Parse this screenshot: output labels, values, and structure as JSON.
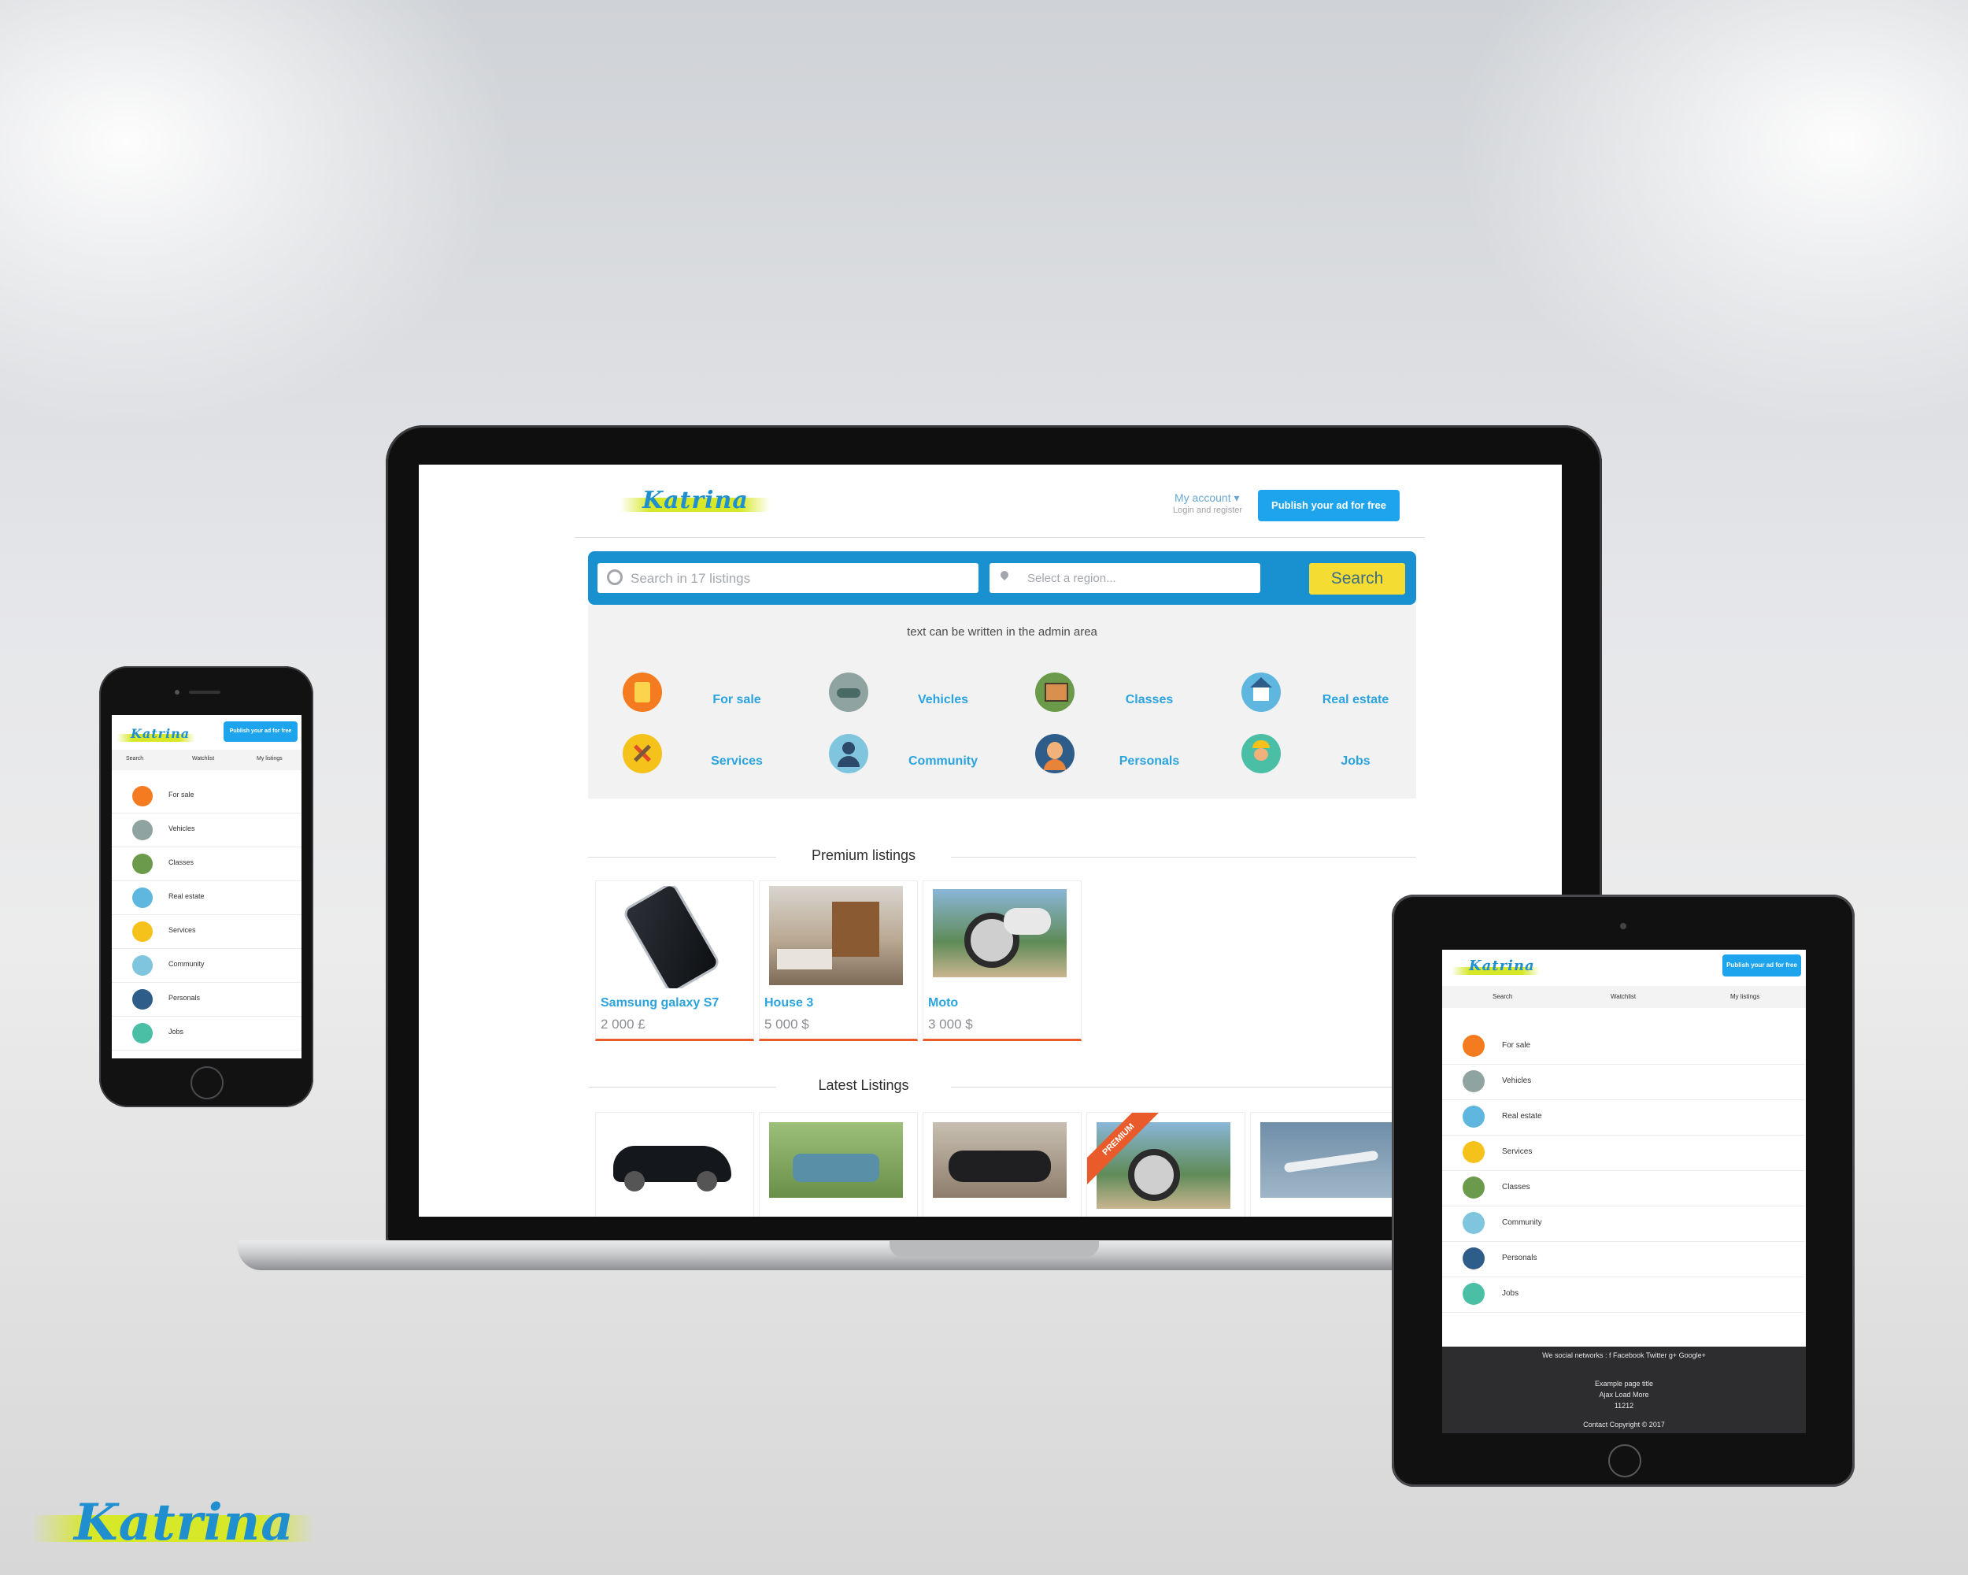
{
  "brand": {
    "logo_text": "Katrina",
    "accent": "#1ea4ec",
    "highlight": "#d6e828",
    "search_button_color": "#f5dc33",
    "price_underline": "#e95b2a"
  },
  "header": {
    "my_account": "My account ▾",
    "login_register": "Login and register",
    "publish_button": "Publish your ad for free"
  },
  "search": {
    "keyword_placeholder": "Search in 17 listings",
    "region_placeholder": "Select a region...",
    "button": "Search"
  },
  "admin_text": "text can be written in the admin area",
  "categories": [
    {
      "label": "For sale",
      "icon": "document-icon",
      "color": "#f47b20"
    },
    {
      "label": "Vehicles",
      "icon": "car-icon",
      "color": "#8fa3a0"
    },
    {
      "label": "Classes",
      "icon": "classroom-icon",
      "color": "#6a9a4a"
    },
    {
      "label": "Real estate",
      "icon": "house-icon",
      "color": "#5fb7e0"
    },
    {
      "label": "Services",
      "icon": "tools-icon",
      "color": "#f5c21b"
    },
    {
      "label": "Community",
      "icon": "people-icon",
      "color": "#7ec5dd"
    },
    {
      "label": "Personals",
      "icon": "person-icon",
      "color": "#2e5d8a"
    },
    {
      "label": "Jobs",
      "icon": "worker-icon",
      "color": "#4bbfa5"
    }
  ],
  "premium": {
    "title": "Premium listings",
    "items": [
      {
        "title": "Samsung galaxy S7",
        "price": "2 000 £",
        "image": "smartphone-image"
      },
      {
        "title": "House 3",
        "price": "5 000 $",
        "image": "living-room-image"
      },
      {
        "title": "Moto",
        "price": "3 000 $",
        "image": "motorcycle-image"
      }
    ]
  },
  "latest": {
    "title": "Latest Listings",
    "badge": "PREMIUM",
    "items": [
      {
        "image": "sports-car-image"
      },
      {
        "image": "sidecar-motorcycle-image"
      },
      {
        "image": "chopper-motorcycle-image"
      },
      {
        "image": "premium-motorcycle-image"
      },
      {
        "image": "private-jet-image"
      }
    ]
  },
  "mobile": {
    "publish_button": "Publish your ad for free",
    "tabs": [
      "Search",
      "Watchlist",
      "My listings"
    ],
    "categories": [
      "For sale",
      "Vehicles",
      "Classes",
      "Real estate",
      "Services",
      "Community",
      "Personals",
      "Jobs"
    ]
  },
  "tablet": {
    "publish_button": "Publish your ad for free",
    "tabs": [
      "Search",
      "Watchlist",
      "My listings"
    ],
    "categories": [
      "For sale",
      "Vehicles",
      "Real estate",
      "Services",
      "Classes",
      "Community",
      "Personals",
      "Jobs"
    ],
    "footer": {
      "social": "We social networks : f Facebook  Twitter  g+ Google+",
      "line1": "Example page title",
      "line2": "Ajax Load More",
      "line3": "11212",
      "copyright": "Contact Copyright © 2017"
    }
  },
  "bottom_logo": "Katrina"
}
